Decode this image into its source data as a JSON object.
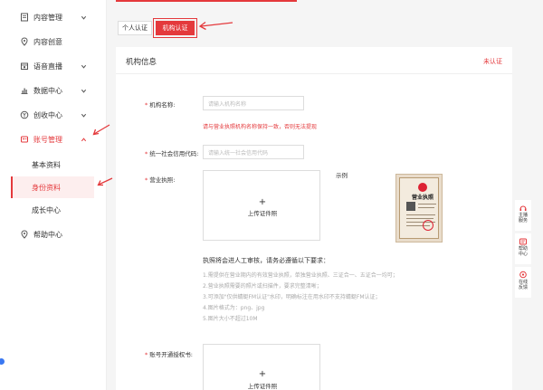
{
  "sidebar": {
    "items": [
      {
        "label": "内容管理",
        "icon": "document-icon",
        "chevron": "down"
      },
      {
        "label": "内容创意",
        "icon": "location-icon",
        "chevron": ""
      },
      {
        "label": "语音直播",
        "icon": "calendar-icon",
        "chevron": "down"
      },
      {
        "label": "数据中心",
        "icon": "chart-icon",
        "chevron": "down"
      },
      {
        "label": "创收中心",
        "icon": "money-icon",
        "chevron": "down"
      },
      {
        "label": "账号管理",
        "icon": "account-icon",
        "chevron": "up"
      },
      {
        "label": "帮助中心",
        "icon": "help-icon",
        "chevron": ""
      }
    ],
    "subitems": [
      {
        "label": "基本资料"
      },
      {
        "label": "身份资料"
      },
      {
        "label": "成长中心"
      }
    ]
  },
  "tabs": [
    {
      "label": "个人认证"
    },
    {
      "label": "机构认证"
    }
  ],
  "card": {
    "title": "机构信息",
    "status": "未认证"
  },
  "form": {
    "name_label": "机构名称:",
    "name_placeholder": "请输入机构名称",
    "name_warning": "请与营业执照机构名称保持一致，否则无法提现",
    "credit_label": "统一社会信用代码:",
    "credit_placeholder": "请输入统一社会信用代码",
    "license_label": "营业执照:",
    "upload_plus": "+",
    "upload_text": "上传证件照",
    "sample_label": "示例",
    "sample_title": "营业执照",
    "requirements_title": "执照将会进人工审核，请务必遵循以下要求：",
    "requirements": [
      "1.需提供在营业期内的有效营业执照，单独营业执照、三证合一、五证合一均可；",
      "2.营业执照需要的照片或扫描件，要求完整清晰；",
      "3.可添加\"仅供蜻蜓FM认证\"水印，明确标注在用水印不支持蜻蜓FM认证；",
      "4.图片格式为：png、jpg",
      "5.图片大小不超过10M"
    ],
    "auth_label": "账号开通授权书:"
  },
  "float_bar": [
    {
      "icon": "service-icon",
      "text": "主播服务"
    },
    {
      "icon": "help-icon",
      "text": "帮助中心"
    },
    {
      "icon": "feedback-icon",
      "text": "在线反馈"
    }
  ],
  "colors": {
    "accent": "#e4393c"
  }
}
